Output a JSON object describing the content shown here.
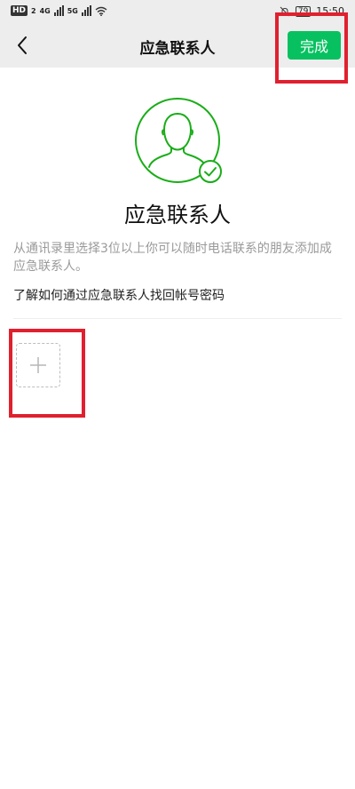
{
  "status_bar": {
    "hd_label": "HD",
    "hd_sub": "2",
    "net1": "4G",
    "net2": "5G",
    "battery": "79",
    "time": "15:50"
  },
  "header": {
    "title": "应急联系人",
    "done_label": "完成"
  },
  "main": {
    "heading": "应急联系人",
    "description": "从通讯录里选择3位以上你可以随时电话联系的朋友添加成应急联系人。",
    "help_link": "了解如何通过应急联系人找回帐号密码"
  },
  "colors": {
    "accent": "#07c160",
    "highlight": "#e0202f"
  },
  "icons": {
    "back": "chevron-left-icon",
    "avatar": "person-silhouette-icon",
    "check": "check-circle-icon",
    "add": "plus-icon"
  }
}
